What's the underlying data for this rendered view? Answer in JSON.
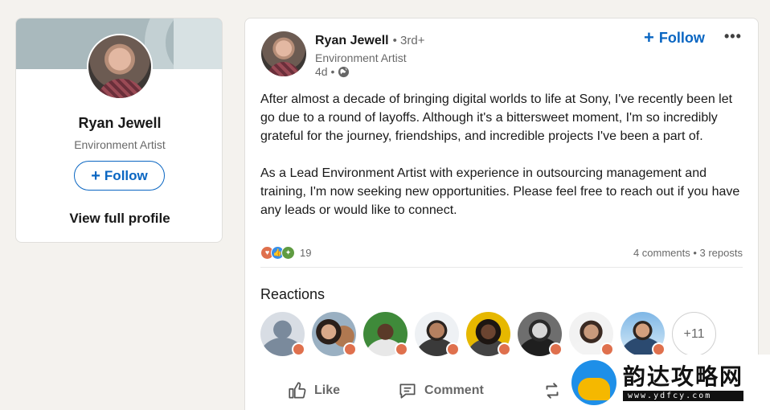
{
  "profile_card": {
    "name": "Ryan Jewell",
    "headline": "Environment Artist",
    "follow_label": "Follow",
    "view_profile_label": "View full profile"
  },
  "post": {
    "author_name": "Ryan Jewell",
    "degree": "• 3rd+",
    "author_title": "Environment Artist",
    "time": "4d •",
    "follow_label": "Follow",
    "more_label": "•••",
    "body_paragraphs": [
      "After almost a decade of bringing digital worlds to life at Sony, I've recently been let go due to a round of layoffs. Although it's a bittersweet moment, I'm so incredibly grateful for the journey, friendships, and incredible projects I've been a part of.",
      "As a Lead Environment Artist with experience in outsourcing management and training, I'm now seeking new opportunities. Please feel free to reach out if you have any leads or would like to connect."
    ],
    "reaction_count": "19",
    "comments_reposts": "4 comments • 3 reposts",
    "reactions_title": "Reactions",
    "more_reactors": "+11",
    "actions": {
      "like": "Like",
      "comment": "Comment",
      "repost": "R"
    }
  },
  "watermark": {
    "title": "韵达攻略网",
    "url": "www.ydfcy.com"
  },
  "colors": {
    "accent": "#0a66c2",
    "background": "#f4f2ee",
    "love": "#df704d",
    "like": "#378fe9",
    "support": "#5f9b41"
  }
}
